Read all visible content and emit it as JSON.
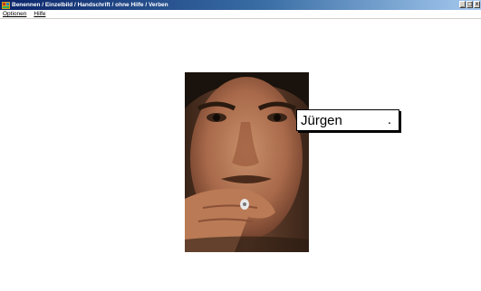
{
  "window": {
    "title": "Benennen / Einzelbild / Handschrift / ohne Hilfe / Verben"
  },
  "title_controls": {
    "minimize": "_",
    "maximize": "□",
    "close": "x"
  },
  "menu": {
    "items": [
      {
        "label": "Optionen"
      },
      {
        "label": "Hilfe"
      }
    ]
  },
  "main": {
    "answer_label": "Jürgen",
    "answer_suffix": "."
  },
  "colors": {
    "titlebar_start": "#0a246a",
    "titlebar_end": "#a6caf0",
    "background": "#ffffff"
  },
  "icons": {
    "app": "app-icon",
    "minimize": "minimize-icon",
    "maximize": "maximize-icon",
    "close": "close-icon"
  }
}
